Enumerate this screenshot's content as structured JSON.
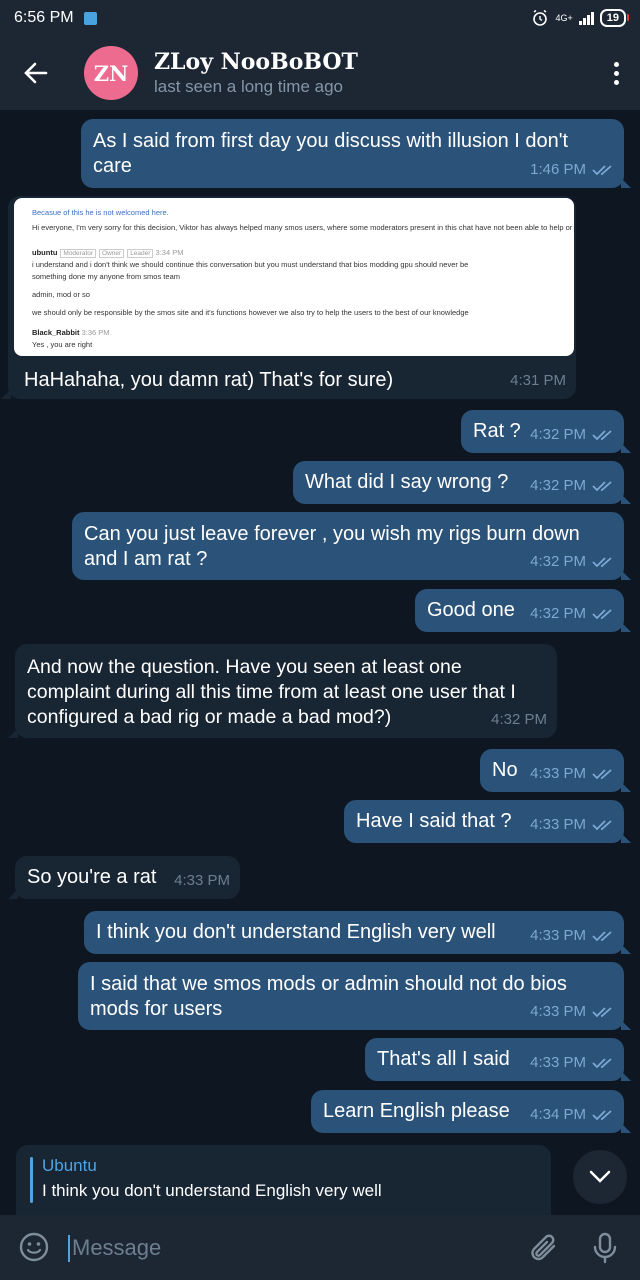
{
  "status_bar": {
    "time": "6:56 PM",
    "network": "4G+",
    "battery": "19"
  },
  "header": {
    "avatar_initials": "ZN",
    "title": "ZLoy NooBoBOT",
    "subtitle": "last seen a long time ago"
  },
  "screenshot_image": {
    "line1": "Becasue of this he is not welcomed here.",
    "line2": "Hi everyone, I'm very sorry for this decision, Viktor has always helped many smos users, where some moderators present in this chat have not been able to help or have",
    "ubuntu_name": "ubuntu",
    "ubuntu_tags": [
      "Moderator",
      "Owner",
      "Leader"
    ],
    "ubuntu_time": "3:34 PM",
    "line3": "i understand and i don't think we should continue this conversation but you must understand that bios modding gpu should never be",
    "line4": "something done my anyone from smos team",
    "line5": "admin, mod or so",
    "line6": "we should only be responsible by the smos site and it's functions however we also try to help the users to the best of our knowledge",
    "rabbit_name": "Black_Rabbit",
    "rabbit_time": "3:36 PM",
    "line7": "Yes , you are right"
  },
  "messages": [
    {
      "text": "As I said from first day you discuss with illusion I don't care",
      "time": "1:46 PM"
    },
    {
      "text": "HaHahaha, you damn rat) That's for sure)",
      "time": "4:31 PM"
    },
    {
      "text": "Rat ?",
      "time": "4:32 PM"
    },
    {
      "text": "What did I say wrong ?",
      "time": "4:32 PM"
    },
    {
      "text": "Can you just leave forever , you wish my rigs burn down and I am rat ?",
      "time": "4:32 PM"
    },
    {
      "text": "Good one",
      "time": "4:32 PM"
    },
    {
      "text": "And now the question. Have you seen at least one complaint during all this time from at least one user that I configured a bad rig or made a bad mod?)",
      "time": "4:32 PM"
    },
    {
      "text": "No",
      "time": "4:33 PM"
    },
    {
      "text": "Have I said that ?",
      "time": "4:33 PM"
    },
    {
      "text": "So you're a rat",
      "time": "4:33 PM"
    },
    {
      "text": "I think you don't understand English very well",
      "time": "4:33 PM"
    },
    {
      "text": "I said that we smos mods or admin should not do bios mods for users",
      "time": "4:33 PM"
    },
    {
      "text": "That's all I said",
      "time": "4:33 PM"
    },
    {
      "text": "Learn English please",
      "time": "4:34 PM"
    }
  ],
  "reply_preview": {
    "name": "Ubuntu",
    "text": "I think you don't understand English very well"
  },
  "composer": {
    "placeholder": "Message"
  },
  "colors": {
    "background": "#0e1621",
    "outgoing_bubble": "#2b5278",
    "incoming_bubble": "#182533",
    "accent": "#4fa3e3",
    "avatar": "#ee6b90"
  }
}
